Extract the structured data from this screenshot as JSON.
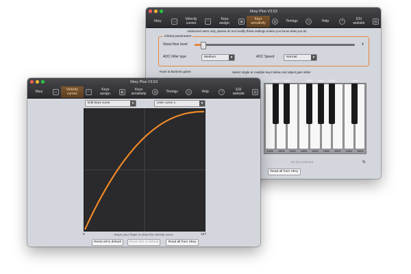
{
  "back_window": {
    "title": "Xkey Plus V3.53",
    "tabs": [
      {
        "label": "Xkey",
        "icon": "keyboard-icon"
      },
      {
        "label": "Velocity\ncurves",
        "icon": "curve-icon"
      },
      {
        "label": "Keys\nassign.",
        "icon": "keys-icon"
      },
      {
        "label": "Keys\nsensitivity",
        "icon": "sensitivity-icon",
        "active": true
      },
      {
        "label": "Timings",
        "icon": "clock-icon"
      },
      {
        "label": "Help",
        "icon": "help-icon"
      },
      {
        "label": "ESI\nwebsite",
        "icon": "web-icon"
      }
    ],
    "warning": "Advanced users only, please do not modify these settings unless you know what you do",
    "global_params_title": "Global parameters",
    "noise_floor_label": "Noise floor level",
    "noise_floor_value": "4",
    "noise_floor_level": 0.04,
    "adc_filter_label": "ADC Filter type",
    "adc_filter_value": "Medium",
    "adc_speed_label": "ADC Speed",
    "adc_speed_value": "Normal",
    "keys_gains_title": "Keys & Buttons gains",
    "keys_gains_hint": "Select single or multiple keys below and adjust gain slider",
    "key_percent": "100%",
    "no_key_selected": "No key selected",
    "percent_sign": "%",
    "read_all_button": "Read all from Xkey"
  },
  "front_window": {
    "title": "Xkey Plus V3.53",
    "tabs": [
      {
        "label": "Xkey",
        "icon": "keyboard-icon"
      },
      {
        "label": "Velocity\ncurves",
        "icon": "curve-icon",
        "active": true
      },
      {
        "label": "Keys\nassign.",
        "icon": "keys-icon"
      },
      {
        "label": "Keys\nsensitivity",
        "icon": "sensitivity-icon"
      },
      {
        "label": "Timings",
        "icon": "clock-icon"
      },
      {
        "label": "Help",
        "icon": "help-icon"
      },
      {
        "label": "ESI\nwebsite",
        "icon": "web-icon"
      }
    ],
    "curve_mode_value": "Edit keys curve",
    "curve_select_value": "User curve 1",
    "axis_min": "0",
    "axis_max": "127",
    "hint": "Swipe your finger to draw the velocity curve",
    "reset_all_button": "Reset all to default",
    "reset_this_button": "Reset this to default",
    "read_all_button": "Read all from Xkey"
  },
  "colors": {
    "accent": "#e8843a",
    "curve": "#f08a28",
    "plot_bg": "#2a2a2c",
    "light_red": "#ff5f57",
    "light_yellow": "#febc2e",
    "light_green": "#28c840"
  }
}
